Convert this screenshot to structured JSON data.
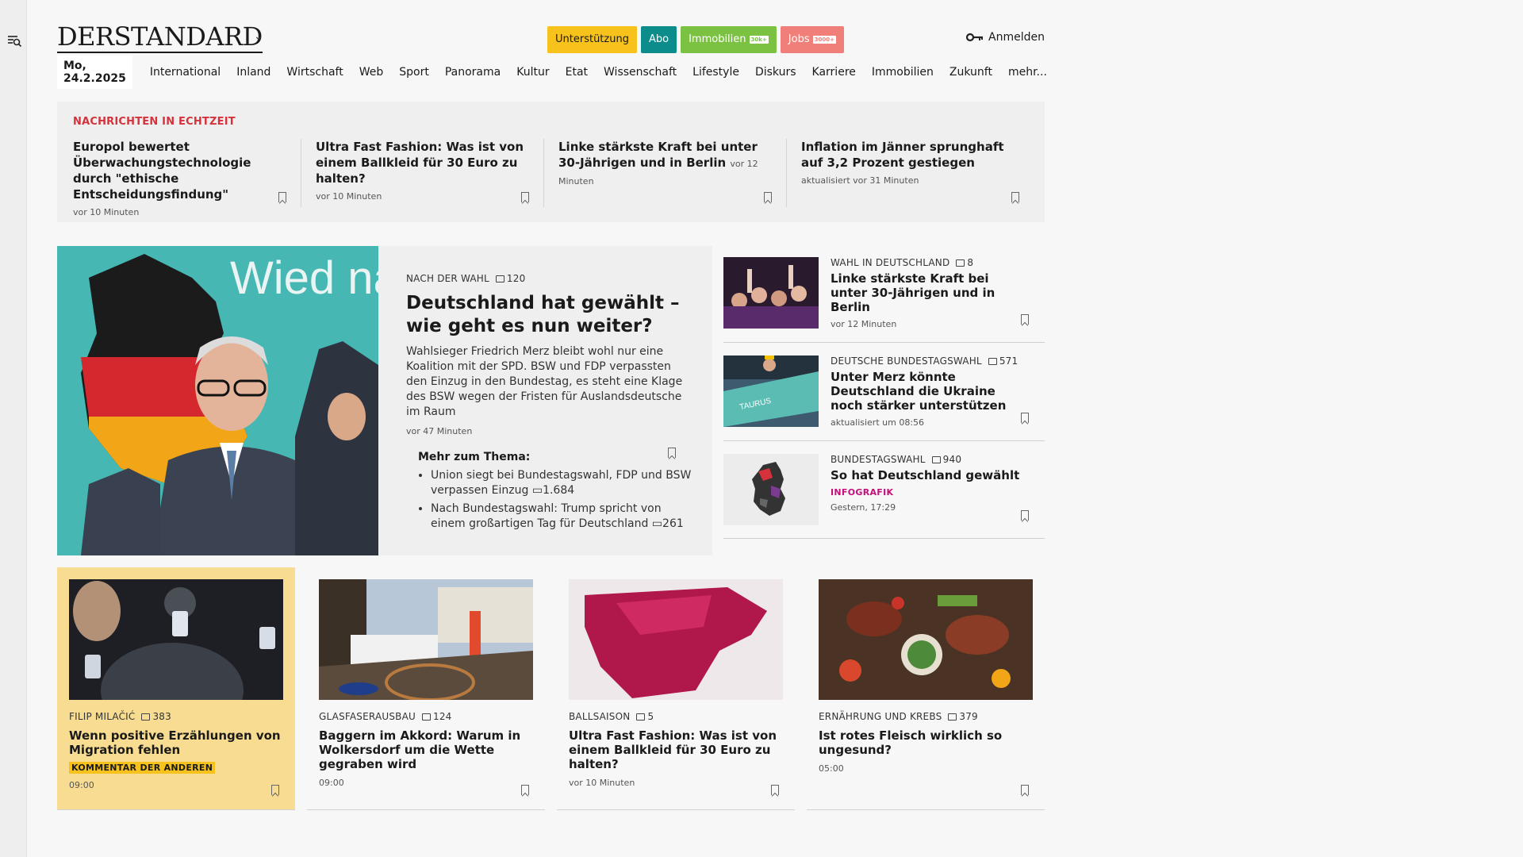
{
  "logo": "DERSTANDARD",
  "header_pills": {
    "support": "Unterstützung",
    "abo": "Abo",
    "immo": "Immobilien",
    "immo_tag": "30k+",
    "jobs": "Jobs",
    "jobs_tag": "3000+"
  },
  "login": "Anmelden",
  "nav": {
    "date": "Mo, 24.2.2025",
    "items": [
      "International",
      "Inland",
      "Wirtschaft",
      "Web",
      "Sport",
      "Panorama",
      "Kultur",
      "Etat",
      "Wissenschaft",
      "Lifestyle",
      "Diskurs",
      "Karriere",
      "Immobilien",
      "Zukunft",
      "mehr..."
    ]
  },
  "ticker": {
    "heading": "NACHRICHTEN IN ECHTZEIT",
    "items": [
      {
        "title": "Europol bewertet Überwachungstechnologie durch \"ethische Entscheidungsfindung\"",
        "time": "vor 10 Minuten"
      },
      {
        "title": "Ultra Fast Fashion: Was ist von einem Ballkleid für 30 Euro zu halten?",
        "time": "vor 10 Minuten"
      },
      {
        "title": "Linke stärkste Kraft bei unter 30-Jährigen und in Berlin",
        "time": "vor 12 Minuten"
      },
      {
        "title": "Inflation im Jänner sprunghaft auf 3,2 Prozent gestiegen",
        "time": "aktualisiert vor 31 Minuten"
      }
    ]
  },
  "hero": {
    "image_text": "Wied nach vorn",
    "kicker": "NACH DER WAHL",
    "comments": "120",
    "title": "Deutschland hat gewählt – wie geht es nun weiter?",
    "lead": "Wahlsieger Friedrich Merz bleibt wohl nur eine Koalition mit der SPD. BSW und FDP verpassten den Einzug in den Bundestag, es steht eine Klage des BSW wegen der Fristen für Auslandsdeutsche im Raum",
    "time": "vor 47 Minuten",
    "more_heading": "Mehr zum Thema:",
    "more": [
      {
        "text": "Union siegt bei Bundestagswahl, FDP und BSW verpassen Einzug",
        "comments": "1.684"
      },
      {
        "text": "Nach Bundestagswahl: Trump spricht von einem großartigen Tag für Deutschland",
        "comments": "261"
      }
    ]
  },
  "side": [
    {
      "kicker": "WAHL IN DEUTSCHLAND",
      "comments": "8",
      "title": "Linke stärkste Kraft bei unter 30-Jährigen und in Berlin",
      "time": "vor 12 Minuten"
    },
    {
      "kicker": "DEUTSCHE BUNDESTAGSWAHL",
      "comments": "571",
      "title": "Unter Merz könnte Deutschland die Ukraine noch stärker unterstützen",
      "time": "aktualisiert um 08:56"
    },
    {
      "kicker": "BUNDESTAGSWAHL",
      "comments": "940",
      "title": "So hat Deutschland gewählt",
      "badge": "INFOGRAFIK",
      "time": "Gestern, 17:29"
    }
  ],
  "cards": [
    {
      "kicker": "FILIP MILAČIĆ",
      "comments": "383",
      "title": "Wenn positive Erzählungen von Migration fehlen",
      "badge": "KOMMENTAR DER ANDEREN",
      "time": "09:00"
    },
    {
      "kicker": "GLASFASERAUSBAU",
      "comments": "124",
      "title": "Baggern im Akkord: Warum in Wolkersdorf um die Wette gegraben wird",
      "time": "09:00"
    },
    {
      "kicker": "BALLSAISON",
      "comments": "5",
      "title": "Ultra Fast Fashion: Was ist von einem Ballkleid für 30 Euro zu halten?",
      "time": "vor 10 Minuten"
    },
    {
      "kicker": "ERNÄHRUNG UND KREBS",
      "comments": "379",
      "title": "Ist rotes Fleisch wirklich so ungesund?",
      "time": "05:00"
    }
  ],
  "colors": {
    "ticker_heading": "#d6323c",
    "support": "#f6c21b",
    "abo": "#0d8c8c",
    "immo": "#7cc242",
    "jobs": "#f07f7a",
    "infografik": "#c40f7a",
    "kommentar_highlight": "#f7dc92"
  }
}
